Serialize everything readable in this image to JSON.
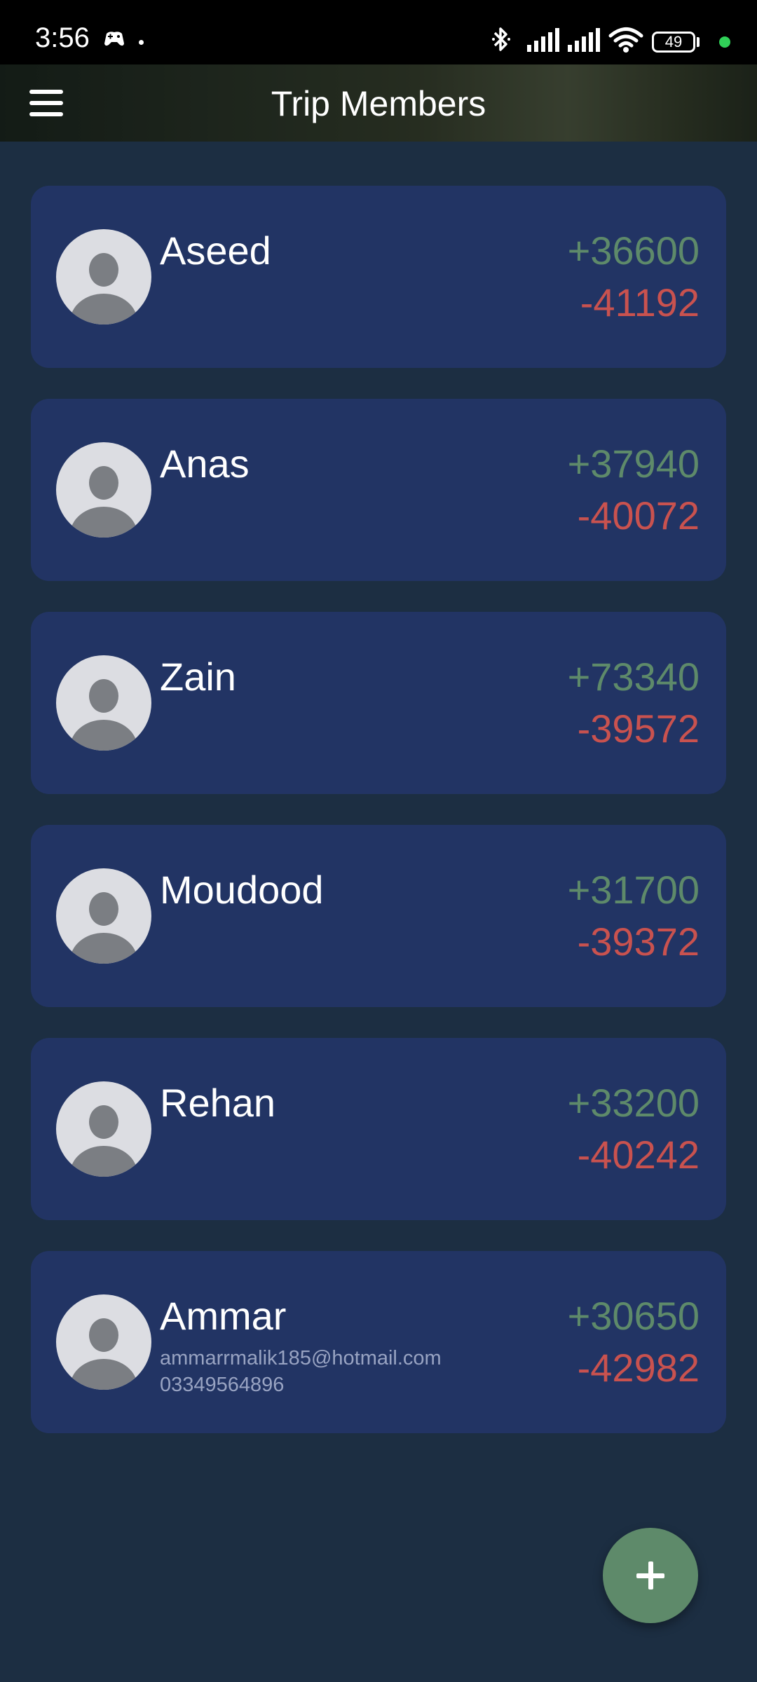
{
  "status_bar": {
    "time": "3:56",
    "battery": "49",
    "icons": [
      "game-controller-icon",
      "bluetooth-icon",
      "signal-icon",
      "signal-icon",
      "wifi-icon",
      "battery-icon",
      "green-dot-icon"
    ]
  },
  "header": {
    "title": "Trip Members",
    "menu_icon": "hamburger-menu-icon"
  },
  "members": [
    {
      "name": "Aseed",
      "email": "",
      "phone": "",
      "plus": "+36600",
      "minus": "-41192"
    },
    {
      "name": "Anas",
      "email": "",
      "phone": "",
      "plus": "+37940",
      "minus": "-40072"
    },
    {
      "name": "Zain",
      "email": "",
      "phone": "",
      "plus": "+73340",
      "minus": "-39572"
    },
    {
      "name": "Moudood",
      "email": "",
      "phone": "",
      "plus": "+31700",
      "minus": "-39372"
    },
    {
      "name": "Rehan",
      "email": "",
      "phone": "",
      "plus": "+33200",
      "minus": "-40242"
    },
    {
      "name": "Ammar",
      "email": "ammarrmalik185@hotmail.com",
      "phone": "03349564896",
      "plus": "+30650",
      "minus": "-42982"
    }
  ],
  "fab": {
    "icon": "plus-icon"
  },
  "colors": {
    "background": "#1c2e42",
    "card": "#223464",
    "positive": "#5e8a6a",
    "negative": "#c9524f",
    "fab": "#5e8a6a"
  }
}
